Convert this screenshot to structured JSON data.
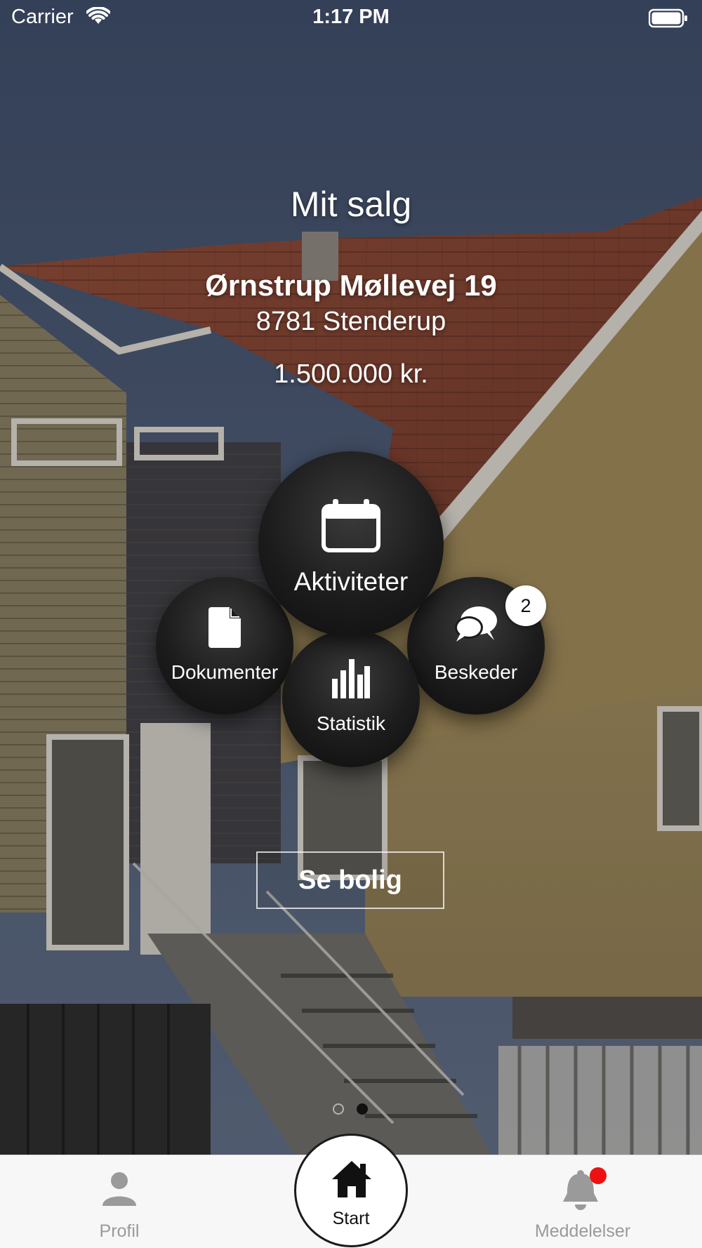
{
  "status_bar": {
    "carrier": "Carrier",
    "time": "1:17 PM",
    "icons": [
      "wifi-icon",
      "battery-icon"
    ]
  },
  "header": {
    "title": "Mit salg"
  },
  "property": {
    "street": "Ørnstrup Møllevej 19",
    "city": "8781 Stenderup",
    "price": "1.500.000 kr."
  },
  "menu": {
    "activities": {
      "label": "Aktiviteter",
      "icon": "calendar-icon"
    },
    "documents": {
      "label": "Dokumenter",
      "icon": "document-icon"
    },
    "messages": {
      "label": "Beskeder",
      "icon": "chat-bubbles-icon",
      "badge": "2"
    },
    "statistics": {
      "label": "Statistik",
      "icon": "bar-chart-icon"
    }
  },
  "cta": {
    "label": "Se bolig"
  },
  "pager": {
    "pages": 2,
    "current": 2
  },
  "tabbar": {
    "tabs": [
      {
        "label": "Profil",
        "icon": "person-icon",
        "active": false
      },
      {
        "label": "Start",
        "icon": "home-icon",
        "active": true
      },
      {
        "label": "Meddelelser",
        "icon": "bell-icon",
        "active": false,
        "has_notification": true
      }
    ]
  },
  "colors": {
    "bubble": "#1c1c1c",
    "notification_dot": "#ee1111",
    "tabbar_bg": "#f7f7f7",
    "tab_inactive": "#9a9a9a"
  }
}
